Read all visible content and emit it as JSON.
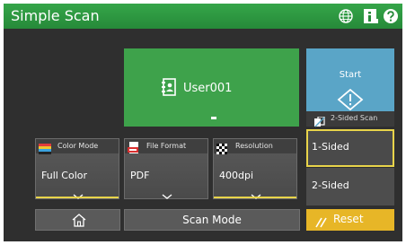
{
  "app": {
    "title": "Simple Scan"
  },
  "header_icons": [
    "globe-icon",
    "info-icon",
    "help-icon"
  ],
  "user": {
    "name": "User001"
  },
  "start": {
    "label": "Start"
  },
  "two_sided_strip": {
    "label": "2-Sided Scan"
  },
  "settings": [
    {
      "label": "Color Mode",
      "value": "Full Color",
      "icon": "color-mode-icon"
    },
    {
      "label": "File Format",
      "value": "PDF",
      "icon": "pdf-file-icon"
    },
    {
      "label": "Resolution",
      "value": "400dpi",
      "icon": "resolution-icon"
    }
  ],
  "sides": {
    "options": [
      "1-Sided",
      "2-Sided"
    ],
    "selected": "1-Sided"
  },
  "footer": {
    "scan_mode_label": "Scan Mode",
    "reset_label": "Reset"
  },
  "colors": {
    "title_bar": "#2e9a42",
    "user_card": "#3ea24b",
    "start_button": "#5aa5c7",
    "accent_yellow": "#e8d44a",
    "reset_button": "#e7b627",
    "background": "#2f2f2f"
  }
}
